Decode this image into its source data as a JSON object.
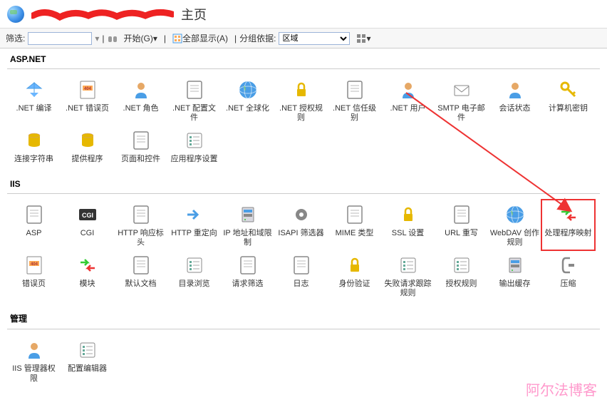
{
  "header": {
    "title": "主页"
  },
  "toolbar": {
    "filter_label": "筛选:",
    "go_label": "开始(G)",
    "show_all_label": "全部显示(A)",
    "group_by_label": "分组依据:",
    "group_by_value": "区域"
  },
  "sections": {
    "aspnet": {
      "title": "ASP.NET",
      "items": [
        {
          "label": ".NET 编译",
          "icon": "compile"
        },
        {
          "label": ".NET 错误页",
          "icon": "error404"
        },
        {
          "label": ".NET 角色",
          "icon": "roles"
        },
        {
          "label": ".NET 配置文件",
          "icon": "config"
        },
        {
          "label": ".NET 全球化",
          "icon": "globe"
        },
        {
          "label": ".NET 授权规则",
          "icon": "authrules"
        },
        {
          "label": ".NET 信任级别",
          "icon": "trust"
        },
        {
          "label": ".NET 用户",
          "icon": "users"
        },
        {
          "label": "SMTP 电子邮件",
          "icon": "smtp"
        },
        {
          "label": "会话状态",
          "icon": "session"
        },
        {
          "label": "计算机密钥",
          "icon": "key"
        },
        {
          "label": "连接字符串",
          "icon": "connstr"
        },
        {
          "label": "提供程序",
          "icon": "providers"
        },
        {
          "label": "页面和控件",
          "icon": "pages"
        },
        {
          "label": "应用程序设置",
          "icon": "appsettings"
        }
      ]
    },
    "iis": {
      "title": "IIS",
      "items": [
        {
          "label": "ASP",
          "icon": "asp"
        },
        {
          "label": "CGI",
          "icon": "cgi"
        },
        {
          "label": "HTTP 响应标头",
          "icon": "httpheaders"
        },
        {
          "label": "HTTP 重定向",
          "icon": "redirect"
        },
        {
          "label": "IP 地址和域限制",
          "icon": "iprestrict"
        },
        {
          "label": "ISAPI 筛选器",
          "icon": "isapi"
        },
        {
          "label": "MIME 类型",
          "icon": "mime"
        },
        {
          "label": "SSL 设置",
          "icon": "ssl"
        },
        {
          "label": "URL 重写",
          "icon": "urlrewrite"
        },
        {
          "label": "WebDAV 创作规则",
          "icon": "webdav"
        },
        {
          "label": "处理程序映射",
          "icon": "handler",
          "highlighted": true
        },
        {
          "label": "错误页",
          "icon": "errorpg"
        },
        {
          "label": "模块",
          "icon": "modules"
        },
        {
          "label": "默认文档",
          "icon": "defaultdoc"
        },
        {
          "label": "目录浏览",
          "icon": "dirbrowse"
        },
        {
          "label": "请求筛选",
          "icon": "reqfilter"
        },
        {
          "label": "日志",
          "icon": "logging"
        },
        {
          "label": "身份验证",
          "icon": "auth"
        },
        {
          "label": "失败请求跟踪规则",
          "icon": "failedreq"
        },
        {
          "label": "授权规则",
          "icon": "authoriz"
        },
        {
          "label": "输出缓存",
          "icon": "outputcache"
        },
        {
          "label": "压缩",
          "icon": "compress"
        }
      ]
    },
    "mgmt": {
      "title": "管理",
      "items": [
        {
          "label": "IIS 管理器权限",
          "icon": "iismgrperm"
        },
        {
          "label": "配置编辑器",
          "icon": "configedit"
        }
      ]
    }
  },
  "watermark": "阿尔法博客"
}
